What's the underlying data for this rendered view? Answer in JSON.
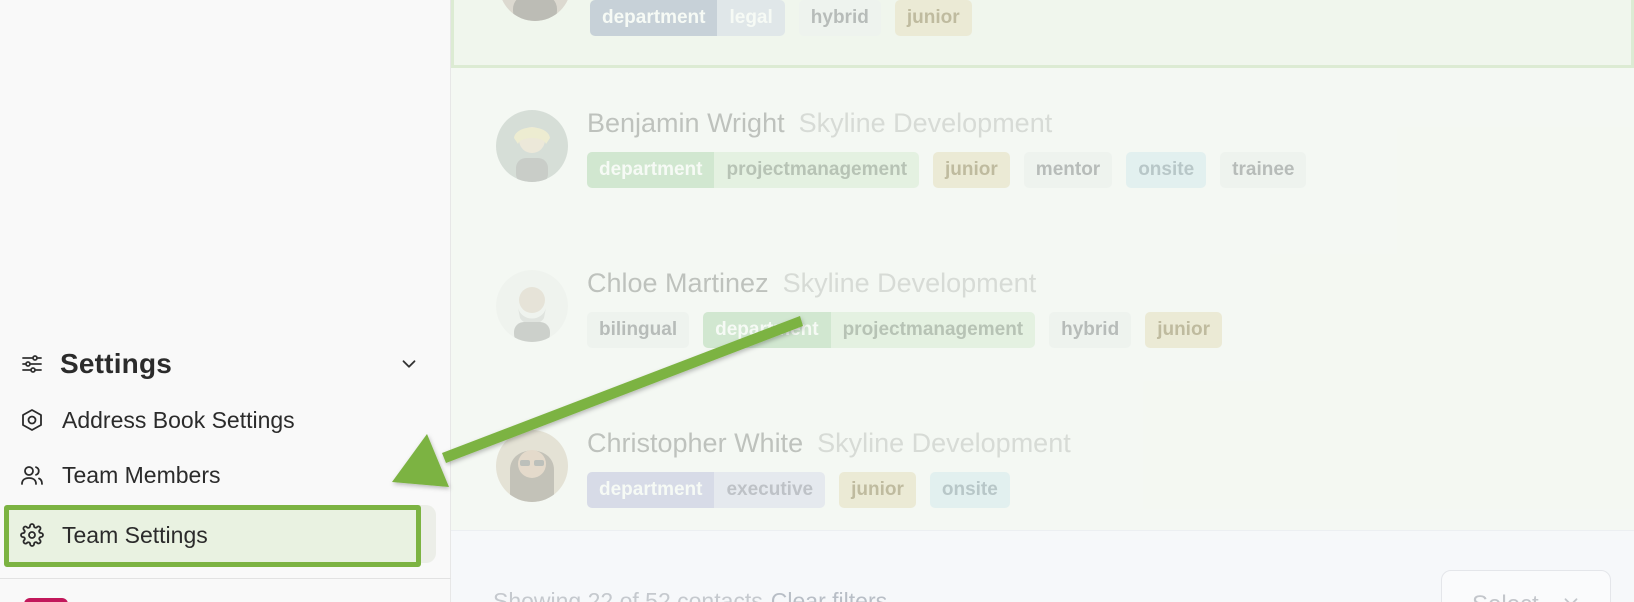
{
  "sidebar": {
    "section_title": "Settings",
    "items": [
      {
        "label": "Address Book Settings",
        "icon": "hexagon-settings-icon"
      },
      {
        "label": "Team Members",
        "icon": "users-icon"
      },
      {
        "label": "Team Settings",
        "icon": "gear-icon"
      }
    ]
  },
  "contacts": [
    {
      "name": "",
      "company": "",
      "tags": [
        {
          "type": "pair",
          "key": "department",
          "value": "legal",
          "key_color": "#a9b5cb",
          "value_bg": "#d7ddea",
          "value_color": "#ffffff"
        },
        {
          "type": "single",
          "label": "hybrid",
          "bg": "#f1f2f3",
          "color": "#8d8f93"
        },
        {
          "type": "single",
          "label": "junior",
          "bg": "#ece2c5",
          "color": "#9c8d63"
        }
      ]
    },
    {
      "name": "Benjamin Wright",
      "company": "Skyline Development",
      "tags": [
        {
          "type": "pair",
          "key": "department",
          "value": "projectmanagement",
          "key_color": "#bcdcbc",
          "value_bg": "#deeedb",
          "value_color": "#8c9b8a"
        },
        {
          "type": "single",
          "label": "junior",
          "bg": "#ece2c5",
          "color": "#9c8d63"
        },
        {
          "type": "single",
          "label": "mentor",
          "bg": "#f1f2f3",
          "color": "#8d8f93"
        },
        {
          "type": "single",
          "label": "onsite",
          "bg": "#dbedf4",
          "color": "#8fa3ad"
        },
        {
          "type": "single",
          "label": "trainee",
          "bg": "#f1f2f3",
          "color": "#8d8f93"
        }
      ]
    },
    {
      "name": "Chloe Martinez",
      "company": "Skyline Development",
      "tags": [
        {
          "type": "single",
          "label": "bilingual",
          "bg": "#f1f2f3",
          "color": "#8d8f93"
        },
        {
          "type": "pair",
          "key": "department",
          "value": "projectmanagement",
          "key_color": "#bcdcbc",
          "value_bg": "#deeedb",
          "value_color": "#8c9b8a"
        },
        {
          "type": "single",
          "label": "hybrid",
          "bg": "#f1f2f3",
          "color": "#8d8f93"
        },
        {
          "type": "single",
          "label": "junior",
          "bg": "#ece2c5",
          "color": "#9c8d63"
        }
      ]
    },
    {
      "name": "Christopher White",
      "company": "Skyline Development",
      "tags": [
        {
          "type": "pair",
          "key": "department",
          "value": "executive",
          "key_color": "#c6c6e6",
          "value_bg": "#e1e1f2",
          "value_color": "#9a9aac"
        },
        {
          "type": "single",
          "label": "junior",
          "bg": "#ece2c5",
          "color": "#9c8d63"
        },
        {
          "type": "single",
          "label": "onsite",
          "bg": "#dbedf4",
          "color": "#8fa3ad"
        }
      ]
    }
  ],
  "footer": {
    "summary": "Showing 22 of 52 contacts",
    "clear_filters": "Clear filters",
    "select_label": "Select"
  },
  "colors": {
    "highlight_border": "#7cb342",
    "annotation_arrow": "#7cb342"
  }
}
